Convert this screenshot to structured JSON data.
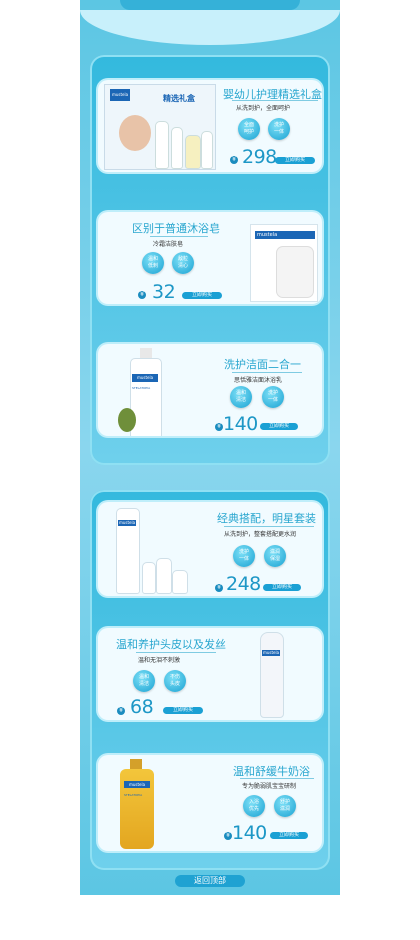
{
  "products": [
    {
      "title": "婴幼儿护理精选礼盒",
      "subtitle": "从洗到护，全面呵护",
      "tags": [
        "全面呵护",
        "洗护一体"
      ],
      "price": "298",
      "buy": "立即购买",
      "box_label": "精选礼盒",
      "box_brand": "mustela"
    },
    {
      "title": "区别于普通沐浴皂",
      "subtitle": "冷霜洁肤皂",
      "tags": [
        "温和低刺",
        "敌粒清心"
      ],
      "price": "32",
      "buy": "立即购买",
      "brand": "mustela"
    },
    {
      "title": "洗护洁面二合一",
      "subtitle": "思恬雅洁面沐浴乳",
      "tags": [
        "温和清洁",
        "洗护一体"
      ],
      "price": "140",
      "buy": "立即购买",
      "brand": "mustela",
      "line": "STELATOPIA"
    },
    {
      "title": "经典搭配，明星套装",
      "subtitle": "从洗到护，整套搭配更水润",
      "tags": [
        "洗护一体",
        "滋润保湿"
      ],
      "price": "248",
      "buy": "立即购买",
      "brand": "mustela"
    },
    {
      "title": "温和养护头皮以及发丝",
      "subtitle": "温和无泪不刺激",
      "tags": [
        "温和清洁",
        "不伤头皮"
      ],
      "price": "68",
      "buy": "立即购买",
      "brand": "mustela"
    },
    {
      "title": "温和舒缓牛奶浴",
      "subtitle": "专为脆弱肌宝宝研制",
      "tags": [
        "入浴优先",
        "舒护滋润"
      ],
      "price": "140",
      "buy": "立即购买",
      "brand": "mustela",
      "line": "STELATOPIA"
    }
  ],
  "currency_symbol": "¥",
  "back_to_top": "返回顶部",
  "colors": {
    "accent": "#1aa0d4",
    "title": "#28a6cf",
    "panel": "#33b9de"
  }
}
